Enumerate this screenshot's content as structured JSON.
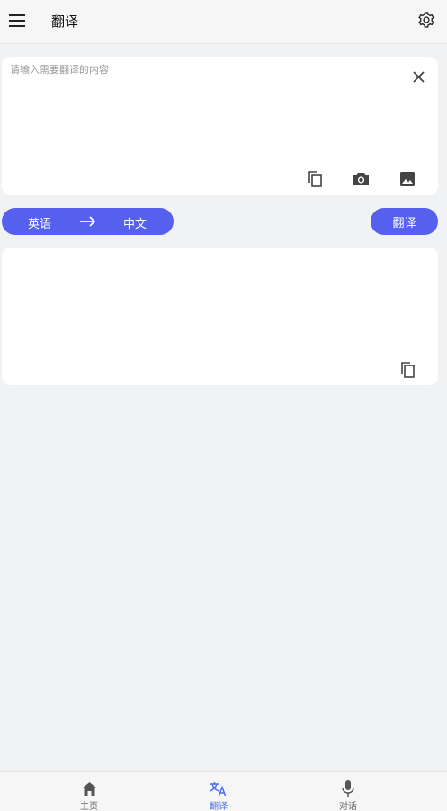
{
  "header": {
    "title": "翻译",
    "menu_icon": "menu-icon",
    "settings_icon": "gear-icon"
  },
  "input": {
    "placeholder": "请输入需要翻译的内容",
    "value": "",
    "tools": [
      "copy-icon",
      "camera-icon",
      "image-icon"
    ]
  },
  "language": {
    "source": "英语",
    "target": "中文"
  },
  "actions": {
    "translate_label": "翻译"
  },
  "output": {
    "text": ""
  },
  "nav": {
    "items": [
      {
        "label": "主页",
        "icon": "home-icon",
        "active": false
      },
      {
        "label": "翻译",
        "icon": "translate-icon",
        "active": true
      },
      {
        "label": "对话",
        "icon": "mic-icon",
        "active": false
      }
    ]
  },
  "colors": {
    "accent": "#5560ee",
    "active_nav": "#4d6cf0",
    "background": "#f1f2f4",
    "card": "#ffffff"
  }
}
